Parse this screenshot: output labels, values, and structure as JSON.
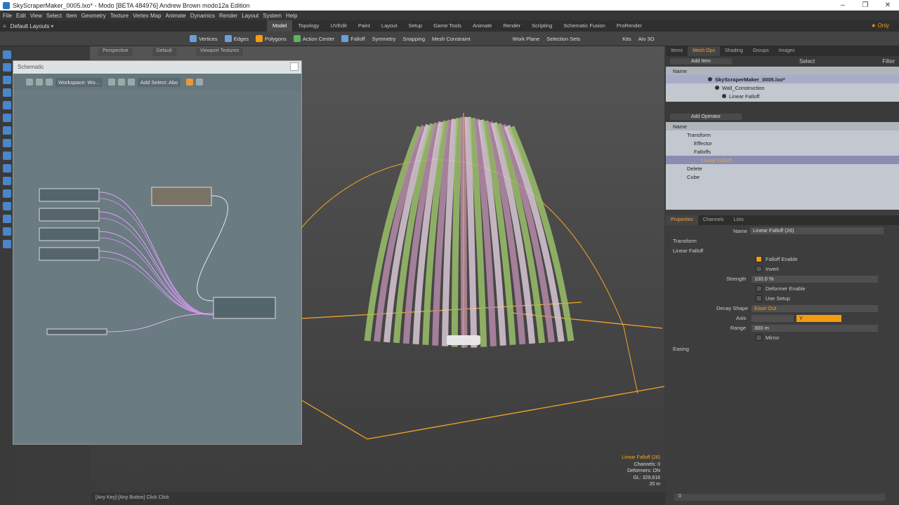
{
  "window": {
    "title": "SkyScraperMaker_0005.lxo* - Modo [BETA 484976] Andrew Brown  modo12a Edition"
  },
  "menu": [
    "File",
    "Edit",
    "View",
    "Select",
    "Item",
    "Geometry",
    "Texture",
    "Vertex Map",
    "Animate",
    "Dynamics",
    "Render",
    "Layout",
    "System",
    "Help"
  ],
  "layouts": {
    "label": "Default Layouts"
  },
  "layout_tabs": [
    "Model",
    "Topology",
    "UVEdit",
    "Paint",
    "Layout",
    "Setup",
    "Game Tools",
    "Animate",
    "Render",
    "Scripting",
    "Schematic Fusion",
    "ProRender"
  ],
  "layout_tab_active": "Model",
  "only_label": "Only",
  "toolbar": {
    "vertices": "Vertices",
    "edges": "Edges",
    "polygons": "Polygons",
    "action_center": "Action Center",
    "falloff": "Falloff",
    "symmetry": "Symmetry",
    "snapping": "Snapping",
    "mesh_constraint": "Mesh Constraint",
    "work_plane": "Work Plane",
    "selection_sets": "Selection Sets",
    "kits": "Kits",
    "atv": "Atv 3O"
  },
  "viewport": {
    "tabs": [
      "Perspective",
      "Default",
      "Viewport Textures"
    ],
    "info": {
      "item": "Linear Falloff (26)",
      "channels": "Channels: 0",
      "deformers": "Deformers: ON",
      "gl": "GL: 329,616",
      "scale": "20 m"
    }
  },
  "status": "[Any Key]-[Any Button] Click  Click",
  "schematic": {
    "title": "Schematic",
    "workspace": "Workspace: Wo...",
    "add_select": "Add Select: Abo"
  },
  "right": {
    "top_tabs": [
      "Items",
      "Mesh Ops",
      "Shading",
      "Groups",
      "Images"
    ],
    "top_tab_active": "Mesh Ops",
    "add_item": "Add Item",
    "select": "Select",
    "filter": "Filter",
    "name_header": "Name",
    "items": [
      {
        "label": "SkyScraperMaker_0005.lxo*",
        "bold": true
      },
      {
        "label": "Wall_Construction"
      },
      {
        "label": "Linear Falloff"
      }
    ],
    "add_operator": "Add Operator",
    "ops_header": "Name",
    "ops": [
      "Transform",
      "Effector",
      "Falloffs",
      "Linear Falloff",
      "Delete",
      "Cube"
    ],
    "prop_tabs": [
      "Properties",
      "Channels",
      "Lists"
    ],
    "prop_tab_active": "Properties",
    "props": {
      "name_label": "Name",
      "name_value": "Linear Falloff (26)",
      "transform": "Transform",
      "linear_falloff": "Linear Falloff",
      "falloff_enable": "Falloff Enable",
      "invert": "Invert",
      "strength_label": "Strength",
      "strength_value": "100.0 %",
      "deformer_enable": "Deformer Enable",
      "use_setup": "Use Setup",
      "decay_label": "Decay Shape",
      "decay_value": "Ease Out",
      "axis_label": "Axis",
      "axis_value": "Y",
      "range_label": "Range",
      "range_value": "300 m",
      "mirror": "Mirror",
      "easing": "Easing"
    },
    "bottom_value": "0"
  },
  "colors": {
    "accent": "#f39c12",
    "viewport_bg": "#4a4a4a",
    "schematic_bg": "#6a7b82"
  }
}
